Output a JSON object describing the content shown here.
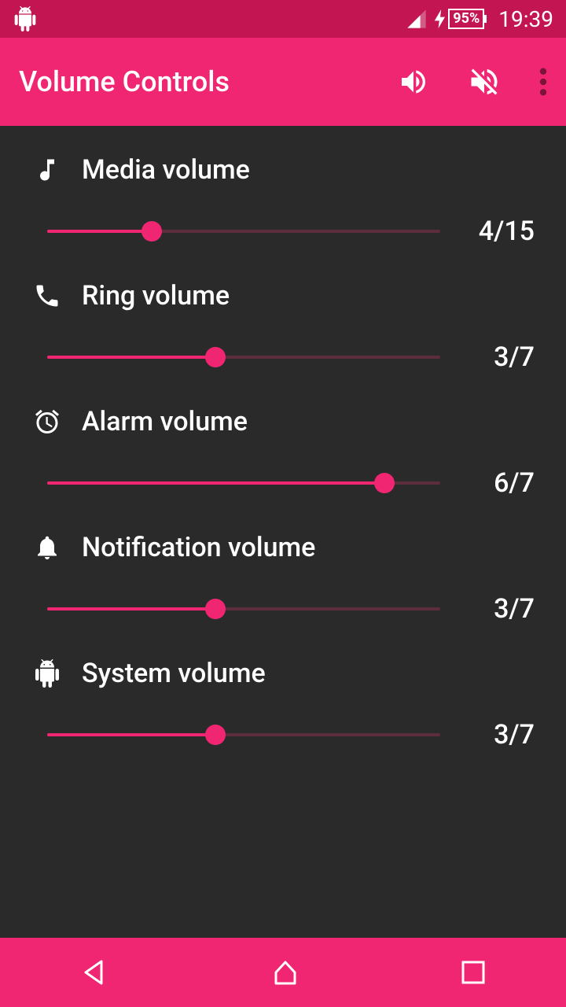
{
  "status": {
    "battery": "95%",
    "time": "19:39"
  },
  "header": {
    "title": "Volume Controls"
  },
  "volumes": [
    {
      "label": "Media volume",
      "value": 4,
      "max": 15,
      "display": "4/15",
      "icon": "music"
    },
    {
      "label": "Ring volume",
      "value": 3,
      "max": 7,
      "display": "3/7",
      "icon": "phone"
    },
    {
      "label": "Alarm volume",
      "value": 6,
      "max": 7,
      "display": "6/7",
      "icon": "alarm"
    },
    {
      "label": "Notification volume",
      "value": 3,
      "max": 7,
      "display": "3/7",
      "icon": "bell"
    },
    {
      "label": "System volume",
      "value": 3,
      "max": 7,
      "display": "3/7",
      "icon": "android"
    }
  ]
}
